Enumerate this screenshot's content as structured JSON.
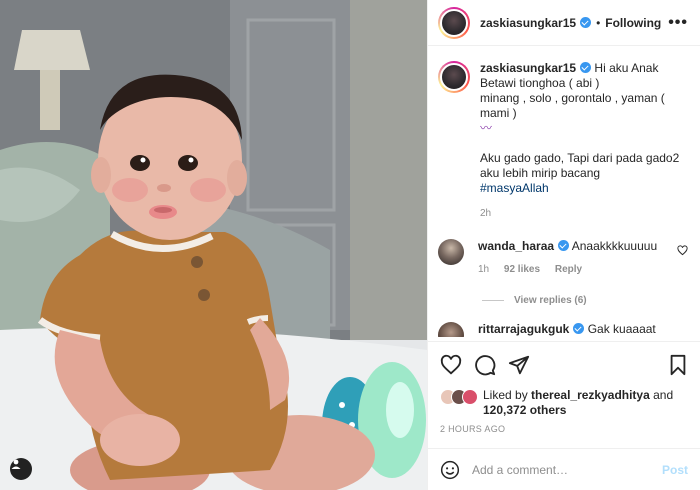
{
  "header": {
    "username": "zaskiasungkar15",
    "separator": "•",
    "follow_label": "Following",
    "more_label": "•••"
  },
  "caption": {
    "username": "zaskiasungkar15",
    "lines": [
      "Hi aku Anak Betawi tionghoa ( abi )",
      "minang , solo , gorontalo , yaman ( mami )"
    ],
    "emoji": "〰",
    "line2": "Aku gado gado, Tapi dari pada gado2 aku lebih mirip bacang",
    "hashtag": "#masyaAllah",
    "time": "2h"
  },
  "comments": [
    {
      "username": "wanda_haraa",
      "text": "Anaakkkkuuuuu",
      "time": "1h",
      "likes": "92 likes",
      "reply_label": "Reply",
      "view_replies": "View replies (6)"
    },
    {
      "username": "rittarrajagukguk",
      "text": "Gak kuaaaat"
    }
  ],
  "likes": {
    "prefix": "Liked by",
    "user": "thereal_rezkyadhitya",
    "middle": "and",
    "count": "120,372 others"
  },
  "posted": "2 HOURS AGO",
  "add_comment": {
    "placeholder": "Add a comment…",
    "post_label": "Post"
  },
  "colors": {
    "verified": "#3897f0",
    "post_button_disabled": "#b2dffc",
    "hashtag": "#00376b",
    "shirt": "#b67a3a"
  },
  "icons": [
    "heart-icon",
    "comment-icon",
    "share-icon",
    "bookmark-icon",
    "emoji-icon",
    "user-tag-icon"
  ]
}
